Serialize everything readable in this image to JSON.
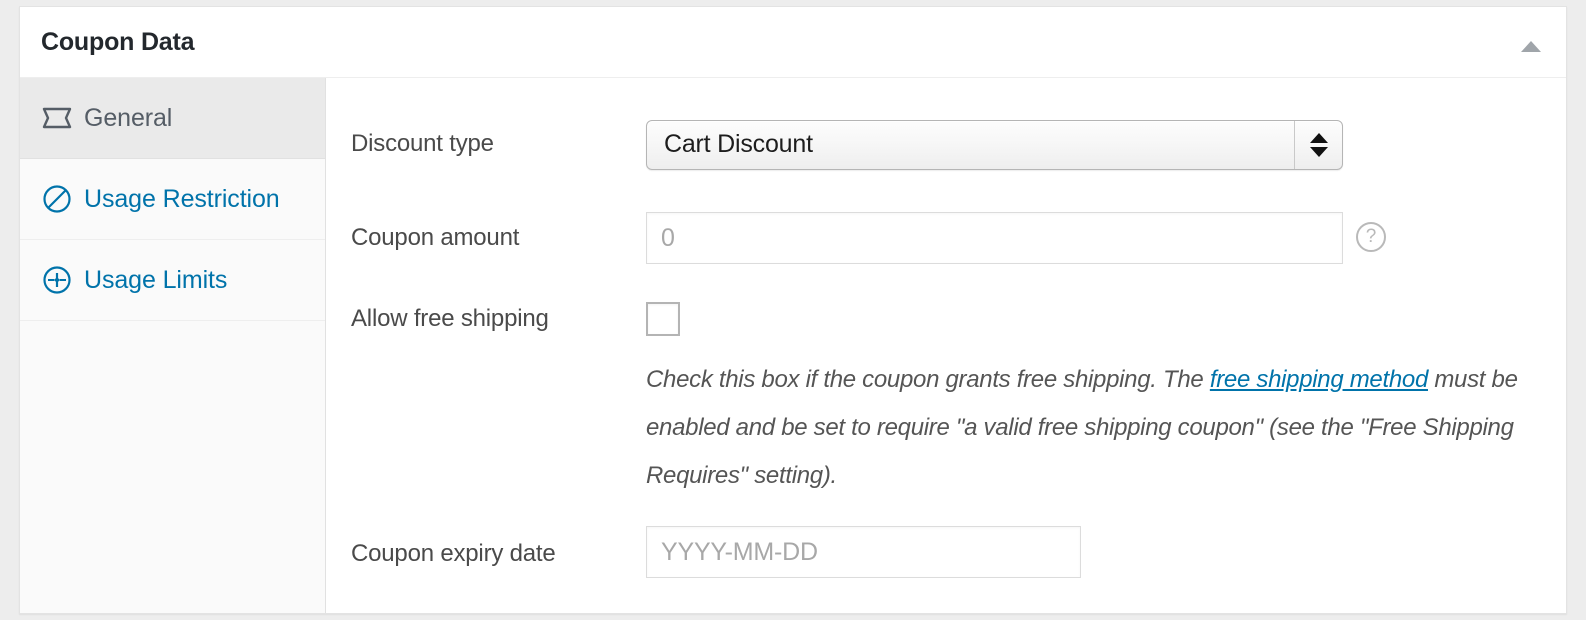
{
  "panel": {
    "title": "Coupon Data",
    "toggle_icon": "triangle-up-icon",
    "toggle_title": "Toggle panel"
  },
  "tabs": [
    {
      "id": "general",
      "label": "General",
      "icon": "coupon-ticket-icon",
      "active": true
    },
    {
      "id": "usage-restriction",
      "label": "Usage Restriction",
      "icon": "prohibition-circle-icon",
      "active": false
    },
    {
      "id": "usage-limits",
      "label": "Usage Limits",
      "icon": "limits-arrows-circle-icon",
      "active": false
    }
  ],
  "fields": {
    "discount_type": {
      "label": "Discount type",
      "value": "Cart Discount",
      "options": [
        "Cart Discount"
      ],
      "stepper_up_icon": "triangle-up-icon",
      "stepper_down_icon": "triangle-down-icon"
    },
    "coupon_amount": {
      "label": "Coupon amount",
      "value": "",
      "placeholder": "0",
      "help_icon": "question-mark-circle-icon"
    },
    "allow_free_shipping": {
      "label": "Allow free shipping",
      "checked": false,
      "description_before": "Check this box if the coupon grants free shipping. The ",
      "description_link": "free shipping method",
      "description_after": " must be enabled and be set to require \"a valid free shipping coupon\" (see the \"Free Shipping Requires\" setting)."
    },
    "coupon_expiry_date": {
      "label": "Coupon expiry date",
      "value": "",
      "placeholder": "YYYY-MM-DD"
    }
  },
  "colors": {
    "link": "#0073aa",
    "text": "#4a4a4a",
    "title": "#23282d",
    "active_tab_bg": "#eaeaea"
  }
}
